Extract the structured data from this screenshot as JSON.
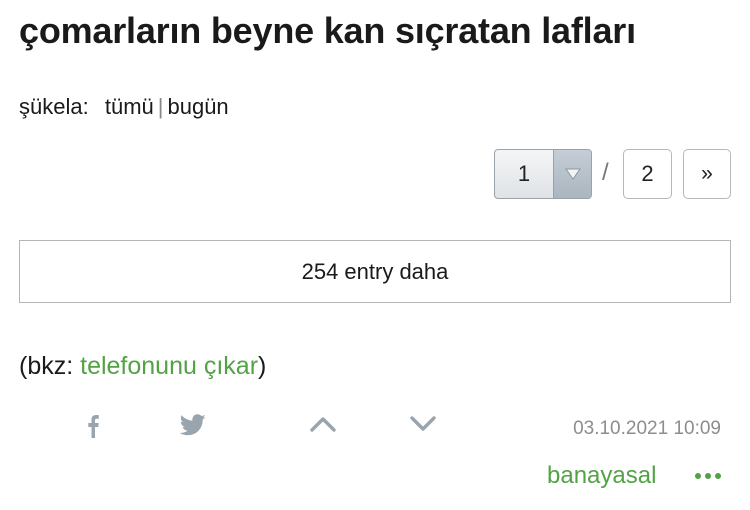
{
  "topic": {
    "title": "çomarların beyne kan sıçratan lafları"
  },
  "filter": {
    "label": "şükela:",
    "options": [
      "tümü",
      "bugün"
    ],
    "separator": "|"
  },
  "pager": {
    "current": "1",
    "slash": "/",
    "total": "2",
    "next": "»"
  },
  "more_entries": {
    "label": "254 entry daha"
  },
  "entry": {
    "prefix": "(bkz: ",
    "link_text": "telefonunu çıkar",
    "suffix": ")",
    "date": "03.10.2021 10:09",
    "author": "banayasal"
  },
  "icons": {
    "facebook": "facebook-icon",
    "twitter": "twitter-icon",
    "upvote": "chevron-up-icon",
    "downvote": "chevron-down-icon",
    "more": "more-dots-icon",
    "dropdown": "dropdown-arrow-icon"
  },
  "colors": {
    "accent_green": "#53a245",
    "icon_gray": "#9aa4ad",
    "date_gray": "#8d8d8d"
  }
}
